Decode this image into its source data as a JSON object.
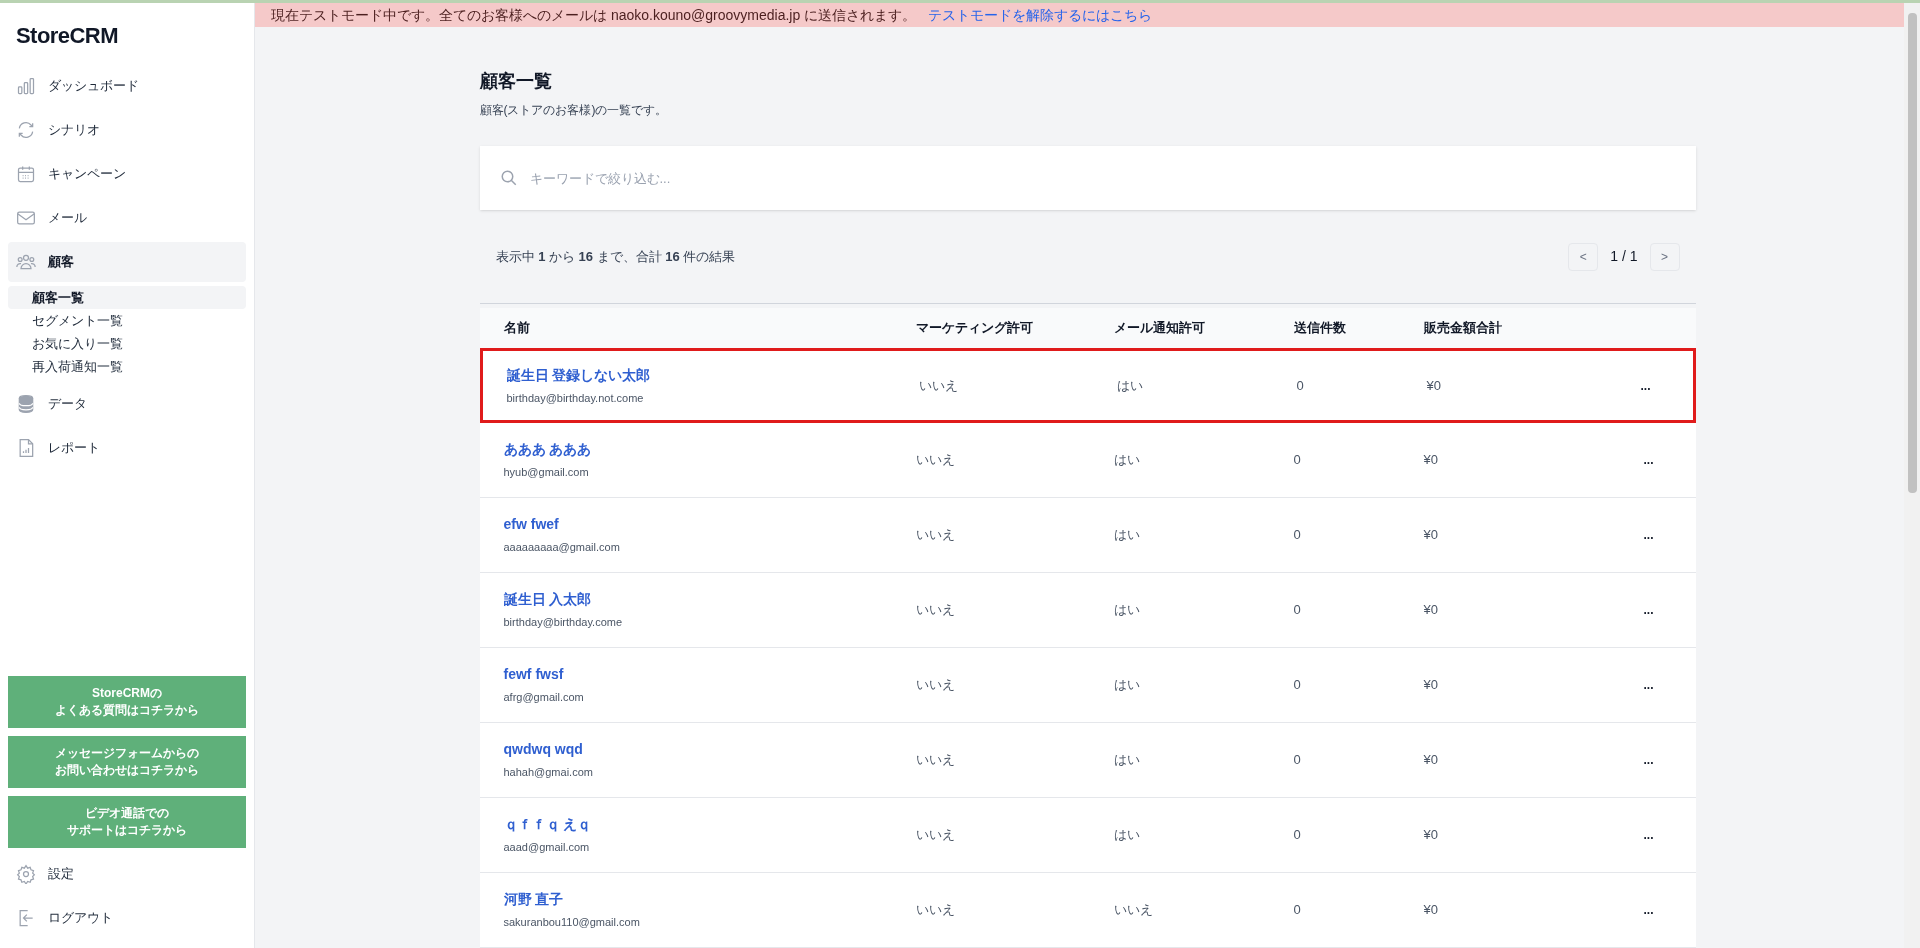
{
  "sidebar": {
    "logo": "StoreCRM",
    "items": [
      {
        "label": "ダッシュボード",
        "selected": false
      },
      {
        "label": "シナリオ",
        "selected": false
      },
      {
        "label": "キャンペーン",
        "selected": false
      },
      {
        "label": "メール",
        "selected": false
      },
      {
        "label": "顧客",
        "selected": true,
        "children": [
          {
            "label": "顧客一覧",
            "selected": true
          },
          {
            "label": "セグメント一覧",
            "selected": false
          },
          {
            "label": "お気に入り一覧",
            "selected": false
          },
          {
            "label": "再入荷通知一覧",
            "selected": false
          }
        ]
      },
      {
        "label": "データ",
        "selected": false
      },
      {
        "label": "レポート",
        "selected": false
      }
    ],
    "help_buttons": [
      [
        "StoreCRMの",
        "よくある質問はコチラから"
      ],
      [
        "メッセージフォームからの",
        "お問い合わせはコチラから"
      ],
      [
        "ビデオ通話での",
        "サポートはコチラから"
      ]
    ],
    "bottom_items": [
      {
        "label": "設定"
      },
      {
        "label": "ログアウト"
      }
    ]
  },
  "banner": {
    "message": "現在テストモード中です。全てのお客様へのメールは naoko.kouno@groovymedia.jp に送信されます。",
    "link": "テストモードを解除するにはこちら"
  },
  "page": {
    "title": "顧客一覧",
    "subtitle": "顧客(ストアのお客様)の一覧です。"
  },
  "search": {
    "placeholder": "キーワードで絞り込む..."
  },
  "summary": "表示中 **1** から **16** まで、合計 **16** 件の結果",
  "pagination": {
    "prev": "<",
    "page": "1 / 1",
    "next": ">"
  },
  "table": {
    "columns": [
      "名前",
      "マーケティング許可",
      "メール通知許可",
      "送信件数",
      "販売金額合計"
    ],
    "rows": [
      {
        "name": "誕生日 登録しない太郎",
        "email": "birthday@birthday.not.come",
        "marketing": "いいえ",
        "notify": "はい",
        "sent": "0",
        "sales": "¥0",
        "menu": "...",
        "highlighted": true
      },
      {
        "name": "あああ あああ",
        "email": "hyub@gmail.com",
        "marketing": "いいえ",
        "notify": "はい",
        "sent": "0",
        "sales": "¥0",
        "menu": "...",
        "highlighted": false
      },
      {
        "name": "efw fwef",
        "email": "aaaaaaaaa@gmail.com",
        "marketing": "いいえ",
        "notify": "はい",
        "sent": "0",
        "sales": "¥0",
        "menu": "...",
        "highlighted": false
      },
      {
        "name": "誕生日 入太郎",
        "email": "birthday@birthday.come",
        "marketing": "いいえ",
        "notify": "はい",
        "sent": "0",
        "sales": "¥0",
        "menu": "...",
        "highlighted": false
      },
      {
        "name": "fewf fwsf",
        "email": "afrg@gmail.com",
        "marketing": "いいえ",
        "notify": "はい",
        "sent": "0",
        "sales": "¥0",
        "menu": "...",
        "highlighted": false
      },
      {
        "name": "qwdwq wqd",
        "email": "hahah@gmai.com",
        "marketing": "いいえ",
        "notify": "はい",
        "sent": "0",
        "sales": "¥0",
        "menu": "...",
        "highlighted": false
      },
      {
        "name": "ｑｆｆｑ えｑ",
        "email": "aaad@gmail.com",
        "marketing": "いいえ",
        "notify": "はい",
        "sent": "0",
        "sales": "¥0",
        "menu": "...",
        "highlighted": false
      },
      {
        "name": "河野 直子",
        "email": "sakuranbou110@gmail.com",
        "marketing": "いいえ",
        "notify": "いいえ",
        "sent": "0",
        "sales": "¥0",
        "menu": "...",
        "highlighted": false
      }
    ]
  }
}
